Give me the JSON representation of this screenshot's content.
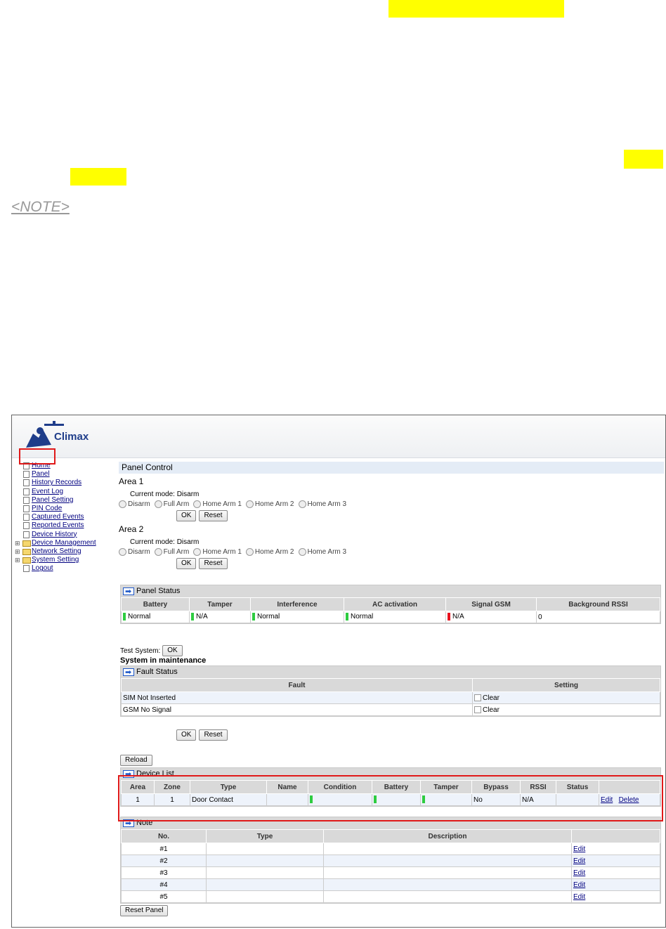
{
  "doc": {
    "note_label": "<NOTE>"
  },
  "app": {
    "logo_text": "Climax"
  },
  "sidebar": {
    "items": [
      {
        "label": "Home",
        "type": "page"
      },
      {
        "label": "Panel",
        "type": "page"
      },
      {
        "label": "History Records",
        "type": "page"
      },
      {
        "label": "Event Log",
        "type": "page"
      },
      {
        "label": "Panel Setting",
        "type": "page"
      },
      {
        "label": "PIN Code",
        "type": "page"
      },
      {
        "label": "Captured Events",
        "type": "page"
      },
      {
        "label": "Reported Events",
        "type": "page"
      },
      {
        "label": "Device History",
        "type": "page"
      },
      {
        "label": "Device Management",
        "type": "folder"
      },
      {
        "label": "Network Setting",
        "type": "folder"
      },
      {
        "label": "System Setting",
        "type": "folder"
      },
      {
        "label": "Logout",
        "type": "page"
      }
    ]
  },
  "panel_control": {
    "title": "Panel Control",
    "areas": [
      {
        "title": "Area 1",
        "mode_label": "Current mode:",
        "mode_value": "Disarm"
      },
      {
        "title": "Area 2",
        "mode_label": "Current mode:",
        "mode_value": "Disarm"
      }
    ],
    "radio_options": [
      "Disarm",
      "Full Arm",
      "Home Arm 1",
      "Home Arm 2",
      "Home Arm 3"
    ],
    "ok_label": "OK",
    "reset_label": "Reset"
  },
  "panel_status": {
    "title": "Panel Status",
    "headers": [
      "Battery",
      "Tamper",
      "Interference",
      "AC activation",
      "Signal GSM",
      "Background RSSI"
    ],
    "values": [
      "Normal",
      "N/A",
      "Normal",
      "Normal",
      "N/A",
      "0"
    ],
    "indicator_colors": [
      "#2ecc40",
      "#2ecc40",
      "#2ecc40",
      "#2ecc40",
      "#e8121f",
      ""
    ]
  },
  "test_system": {
    "label": "Test System:",
    "ok_label": "OK",
    "maintenance_text": "System in maintenance"
  },
  "fault_status": {
    "title": "Fault Status",
    "headers": [
      "Fault",
      "Setting"
    ],
    "rows": [
      {
        "fault": "SIM Not Inserted",
        "setting": "Clear"
      },
      {
        "fault": "GSM No Signal",
        "setting": "Clear"
      }
    ],
    "ok_label": "OK",
    "reset_label": "Reset"
  },
  "reload_label": "Reload",
  "device_list": {
    "title": "Device List",
    "headers": [
      "Area",
      "Zone",
      "Type",
      "Name",
      "Condition",
      "Battery",
      "Tamper",
      "Bypass",
      "RSSI",
      "Status"
    ],
    "rows": [
      {
        "area": "1",
        "zone": "1",
        "type": "Door Contact",
        "name": "",
        "bypass": "No",
        "rssi": "N/A",
        "status": "",
        "edit": "Edit",
        "delete": "Delete"
      }
    ]
  },
  "note_table": {
    "title": "Note",
    "headers": [
      "No.",
      "Type",
      "Description"
    ],
    "rows": [
      {
        "no": "#1",
        "edit": "Edit"
      },
      {
        "no": "#2",
        "edit": "Edit"
      },
      {
        "no": "#3",
        "edit": "Edit"
      },
      {
        "no": "#4",
        "edit": "Edit"
      },
      {
        "no": "#5",
        "edit": "Edit"
      }
    ]
  },
  "reset_panel_label": "Reset Panel",
  "colors": {
    "highlight": "#ffff00",
    "annotation_box": "#e01919",
    "link": "#000080",
    "header_bg": "#d9d9d9"
  }
}
